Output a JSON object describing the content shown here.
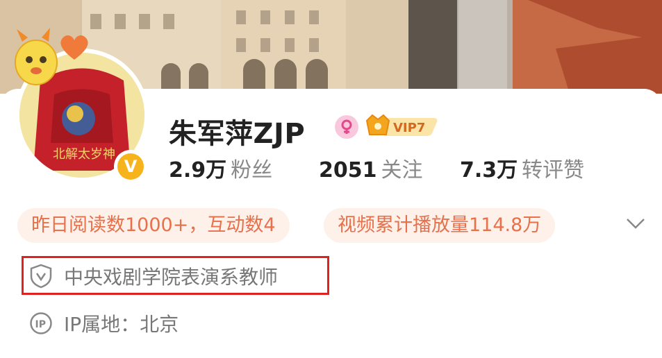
{
  "profile": {
    "name": "朱军萍ZJP",
    "vip_label": "VIP7",
    "stats": [
      {
        "value": "2.9万",
        "label": "粉丝"
      },
      {
        "value": "2051",
        "label": "关注"
      },
      {
        "value": "7.3万",
        "label": "转评赞"
      }
    ],
    "tags": [
      "昨日阅读数1000+，互动数4",
      "视频累计播放量114.8万"
    ],
    "verification": "中央戏剧学院表演系教师",
    "ip_location": "IP属地：北京",
    "avatar_text": "北解太岁神"
  },
  "colors": {
    "accent": "#e8704a",
    "pill_bg": "#fdf1ea",
    "verified": "#f6b31c",
    "highlight_border": "#e0221f",
    "vip": "#f2a51d"
  }
}
